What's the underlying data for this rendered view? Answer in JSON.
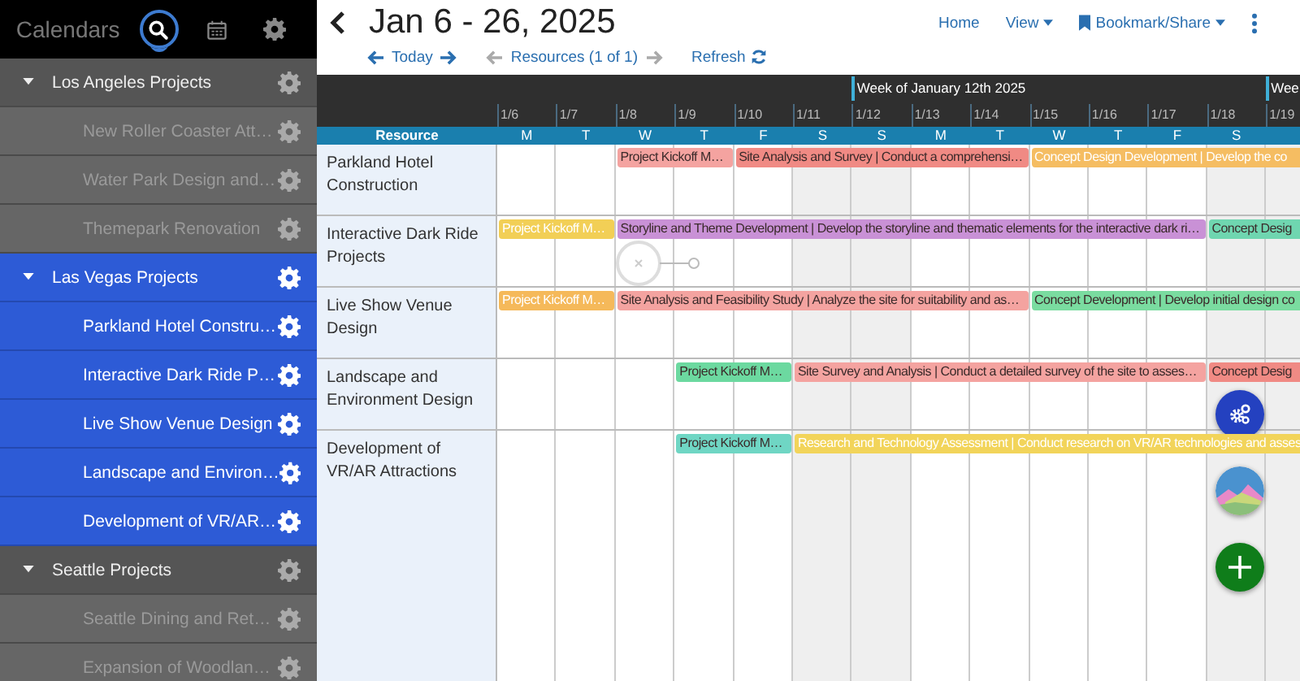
{
  "sidebar": {
    "tabs": [
      {
        "kind": "label",
        "label": "Calendars",
        "selected": false
      },
      {
        "kind": "search",
        "selected": true
      },
      {
        "kind": "calendar",
        "selected": false
      },
      {
        "kind": "settings",
        "selected": false
      }
    ],
    "items": [
      {
        "label": "Los Angeles Projects",
        "expanded": true,
        "selected": false,
        "children": [
          {
            "label": "New Roller Coaster Att…",
            "selected": false
          },
          {
            "label": "Water Park Design and…",
            "selected": false
          },
          {
            "label": "Themepark Renovation",
            "selected": false
          }
        ]
      },
      {
        "label": "Las Vegas Projects",
        "expanded": true,
        "selected": true,
        "children": [
          {
            "label": "Parkland Hotel Constru…",
            "selected": true
          },
          {
            "label": "Interactive Dark Ride P…",
            "selected": true
          },
          {
            "label": "Live Show Venue Design",
            "selected": true
          },
          {
            "label": "Landscape and Environ…",
            "selected": true
          },
          {
            "label": "Development of VR/AR…",
            "selected": true
          }
        ]
      },
      {
        "label": "Seattle Projects",
        "expanded": true,
        "selected": false,
        "children": [
          {
            "label": "Seattle Dining and Ret…",
            "selected": false
          },
          {
            "label": "Expansion of Woodlan…",
            "selected": false
          }
        ]
      }
    ]
  },
  "header": {
    "title": "Jan 6 - 26, 2025",
    "links": [
      {
        "label": "Home",
        "kind": "link"
      },
      {
        "label": "View",
        "kind": "menu"
      },
      {
        "label": "Bookmark/Share",
        "kind": "bookmark"
      }
    ],
    "nav": {
      "today": "Today",
      "resources": "Resources (1 of 1)",
      "refresh": "Refresh"
    }
  },
  "schedule": {
    "resource_heading": "Resource",
    "columns": [
      {
        "date": "1/6",
        "day": "M",
        "weekend": false
      },
      {
        "date": "1/7",
        "day": "T",
        "weekend": false
      },
      {
        "date": "1/8",
        "day": "W",
        "weekend": false
      },
      {
        "date": "1/9",
        "day": "T",
        "weekend": false
      },
      {
        "date": "1/10",
        "day": "F",
        "weekend": false
      },
      {
        "date": "1/11",
        "day": "S",
        "weekend": true
      },
      {
        "date": "1/12",
        "day": "S",
        "weekend": true,
        "week_label": "Week of January 12th 2025"
      },
      {
        "date": "1/13",
        "day": "M",
        "weekend": false
      },
      {
        "date": "1/14",
        "day": "T",
        "weekend": false
      },
      {
        "date": "1/15",
        "day": "W",
        "weekend": false
      },
      {
        "date": "1/16",
        "day": "T",
        "weekend": false
      },
      {
        "date": "1/17",
        "day": "F",
        "weekend": false
      },
      {
        "date": "1/18",
        "day": "S",
        "weekend": true
      },
      {
        "date": "1/19",
        "weekend": true,
        "week_label": "Wee"
      }
    ],
    "rows": [
      {
        "resource": "Parkland Hotel Construction",
        "cells": [
          {
            "kind": "empty"
          },
          {
            "kind": "empty"
          },
          {
            "kind": "event",
            "title": "Project Kickoff M…",
            "color": "#f4a3a0",
            "light_text": false
          },
          {
            "kind": "continued"
          },
          {
            "kind": "event",
            "title": "Site Analysis and Survey | Conduct a comprehensi…",
            "color": "#f08a84",
            "light_text": false
          },
          {
            "kind": "continued"
          },
          {
            "kind": "continued"
          },
          {
            "kind": "continued"
          },
          {
            "kind": "continued"
          },
          {
            "kind": "event",
            "title": "Concept Design Development | Develop the co",
            "color": "#f5bd62",
            "light_text": true
          },
          {
            "kind": "continued"
          },
          {
            "kind": "continued"
          },
          {
            "kind": "continued"
          },
          {
            "kind": "continued"
          }
        ]
      },
      {
        "resource": "Interactive Dark Ride Projects",
        "cells": [
          {
            "kind": "event",
            "title": "Project Kickoff M…",
            "color": "#f2cf56",
            "light_text": true
          },
          {
            "kind": "continued"
          },
          {
            "kind": "event",
            "title": "Storyline and Theme Development | Develop the storyline and thematic elements for the interactive dark ri…",
            "color": "#c991d6",
            "light_text": false,
            "link_handle": true
          },
          {
            "kind": "continued"
          },
          {
            "kind": "continued"
          },
          {
            "kind": "continued"
          },
          {
            "kind": "continued"
          },
          {
            "kind": "continued"
          },
          {
            "kind": "continued"
          },
          {
            "kind": "continued"
          },
          {
            "kind": "continued"
          },
          {
            "kind": "continued"
          },
          {
            "kind": "event",
            "title": "Concept Desig",
            "color": "#6fd6b0",
            "light_text": false
          },
          {
            "kind": "continued"
          }
        ]
      },
      {
        "resource": "Live Show Venue Design",
        "cells": [
          {
            "kind": "event",
            "title": "Project Kickoff M…",
            "color": "#f5b95a",
            "light_text": true
          },
          {
            "kind": "continued"
          },
          {
            "kind": "event",
            "title": "Site Analysis and Feasibility Study | Analyze the site for suitability and as…",
            "color": "#f4a3a0",
            "light_text": false
          },
          {
            "kind": "continued"
          },
          {
            "kind": "continued"
          },
          {
            "kind": "continued"
          },
          {
            "kind": "continued"
          },
          {
            "kind": "continued"
          },
          {
            "kind": "continued"
          },
          {
            "kind": "event",
            "title": "Concept Development | Develop initial design co",
            "color": "#7adca0",
            "light_text": false
          },
          {
            "kind": "continued"
          },
          {
            "kind": "continued"
          },
          {
            "kind": "continued"
          },
          {
            "kind": "continued"
          }
        ]
      },
      {
        "resource": "Landscape and Environment Design",
        "cells": [
          {
            "kind": "empty"
          },
          {
            "kind": "empty"
          },
          {
            "kind": "empty"
          },
          {
            "kind": "event",
            "title": "Project Kickoff M…",
            "color": "#6cd9a0",
            "light_text": false
          },
          {
            "kind": "continued"
          },
          {
            "kind": "event",
            "title": "Site Survey and Analysis | Conduct a detailed survey of the site to asses…",
            "color": "#f4a3a0",
            "light_text": false
          },
          {
            "kind": "continued"
          },
          {
            "kind": "continued"
          },
          {
            "kind": "continued"
          },
          {
            "kind": "continued"
          },
          {
            "kind": "continued"
          },
          {
            "kind": "continued"
          },
          {
            "kind": "event",
            "title": "Concept Desig",
            "color": "#f08a84",
            "light_text": false
          },
          {
            "kind": "continued"
          }
        ]
      },
      {
        "resource": "Development of VR/AR Attractions",
        "cells": [
          {
            "kind": "empty"
          },
          {
            "kind": "empty"
          },
          {
            "kind": "empty"
          },
          {
            "kind": "event",
            "title": "Project Kickoff M…",
            "color": "#6fd6c4",
            "light_text": false
          },
          {
            "kind": "continued"
          },
          {
            "kind": "event",
            "title": "Research and Technology Assessment | Conduct research on VR/AR technologies and asses",
            "color": "#f2d45a",
            "light_text": true
          },
          {
            "kind": "continued"
          },
          {
            "kind": "continued"
          },
          {
            "kind": "continued"
          },
          {
            "kind": "continued"
          },
          {
            "kind": "continued"
          },
          {
            "kind": "continued"
          },
          {
            "kind": "continued"
          },
          {
            "kind": "continued"
          }
        ]
      }
    ]
  },
  "fab_buttons": [
    {
      "kind": "settings"
    },
    {
      "kind": "picture"
    },
    {
      "kind": "add"
    }
  ]
}
